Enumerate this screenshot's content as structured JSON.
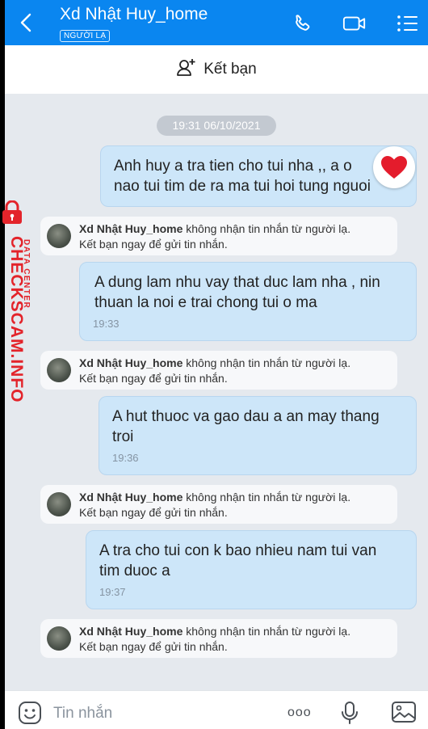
{
  "header": {
    "title": "Xd Nhật Huy_home",
    "tag": "NGƯỜI LẠ",
    "icons": [
      "back-arrow-icon",
      "phone-icon",
      "video-call-icon",
      "menu-list-icon"
    ],
    "color": "#0a86f0"
  },
  "add_friend": {
    "label": "Kết bạn",
    "icon": "add-friend-icon"
  },
  "chat": {
    "date_stamp": "19:31 06/10/2021",
    "notice": {
      "name": "Xd Nhật Huy_home",
      "line1_rest": " không nhận tin nhắn từ người lạ.",
      "line2": "Kết bạn ngay để gửi tin nhắn."
    },
    "messages": [
      {
        "text": "Anh huy a tra tien cho tui nha ,, a o\nnao tui tim de ra ma tui  hoi tung nguoi",
        "time": "",
        "reaction": "heart"
      },
      {
        "text": "A dung lam nhu vay that duc lam nha , nin\nthuan la noi e trai chong tui o ma",
        "time": "19:33"
      },
      {
        "text": "A hut thuoc va gao dau a an may thang\ntroi",
        "time": "19:36"
      },
      {
        "text": "A tra cho tui con k bao nhieu nam tui van\ntim duoc a",
        "time": "19:37"
      }
    ]
  },
  "input": {
    "placeholder": "Tin nhắn",
    "more": "ooo"
  },
  "watermark": {
    "main": "CHECKSCAM.INFO",
    "sub": "DATA CENTER",
    "color": "#e3242b"
  }
}
